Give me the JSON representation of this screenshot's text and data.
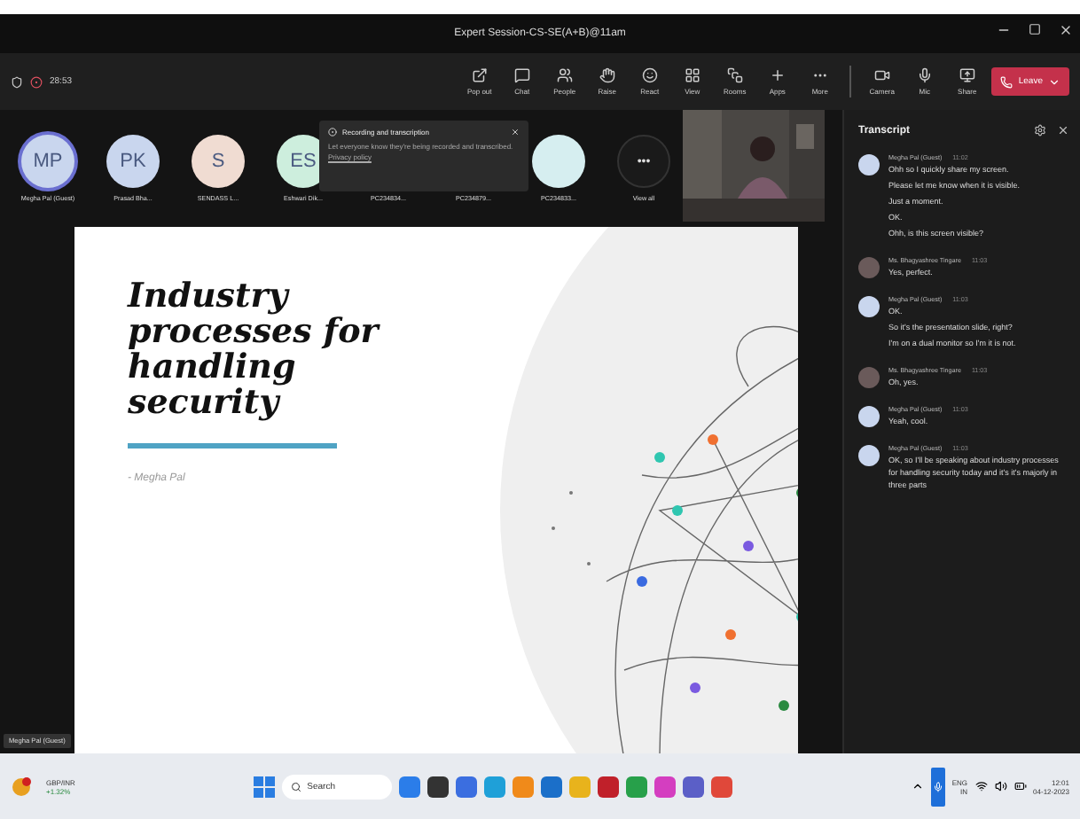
{
  "window": {
    "title": "Expert Session-CS-SE(A+B)@11am"
  },
  "toolbar": {
    "timer": "28:53",
    "buttons": [
      {
        "label": "Pop out"
      },
      {
        "label": "Chat"
      },
      {
        "label": "People"
      },
      {
        "label": "Raise"
      },
      {
        "label": "React"
      },
      {
        "label": "View"
      },
      {
        "label": "Rooms"
      },
      {
        "label": "Apps"
      },
      {
        "label": "More"
      }
    ],
    "device_buttons": [
      {
        "label": "Camera"
      },
      {
        "label": "Mic"
      },
      {
        "label": "Share"
      }
    ],
    "leave": "Leave"
  },
  "participants": [
    {
      "initials": "MP",
      "name": "Megha Pal (Guest)",
      "color": "#c9d6ee",
      "speaking": true
    },
    {
      "initials": "PK",
      "name": "Prasad Bha...",
      "color": "#c9d6ee",
      "speaking": false
    },
    {
      "initials": "S",
      "name": "SENDASS L...",
      "color": "#f0dcd2",
      "speaking": false
    },
    {
      "initials": "ES",
      "name": "Eshwari Dik...",
      "color": "#cdeedd",
      "speaking": false
    },
    {
      "name": "PC234834..."
    },
    {
      "name": "PC234879..."
    },
    {
      "name": "PC234833...",
      "color": "#d6eef0",
      "speaking": false
    }
  ],
  "view_all": {
    "icon": "•••",
    "label": "View all"
  },
  "notice": {
    "title": "Recording and transcription",
    "text": "Let everyone know they're being recorded and transcribed.",
    "link": "Privacy policy"
  },
  "slide": {
    "title": "Industry processes for handling security",
    "author": "- Megha Pal"
  },
  "presenter_label": "Megha Pal (Guest)",
  "transcript": {
    "title": "Transcript",
    "entries": [
      {
        "speaker": "Megha Pal (Guest)",
        "time": "11:02",
        "kind": "guest",
        "lines": [
          "Ohh so I quickly share my screen.",
          "Please let me know when it is visible.",
          "Just a moment.",
          "OK.",
          "Ohh, is this screen visible?"
        ]
      },
      {
        "speaker": "Ms. Bhagyashree Tingare",
        "time": "11:03",
        "kind": "member",
        "lines": [
          "Yes, perfect."
        ]
      },
      {
        "speaker": "Megha Pal (Guest)",
        "time": "11:03",
        "kind": "guest",
        "lines": [
          "OK.",
          "So it's the presentation slide, right?",
          "I'm on a dual monitor so I'm it is not."
        ]
      },
      {
        "speaker": "Ms. Bhagyashree Tingare",
        "time": "11:03",
        "kind": "member",
        "lines": [
          "Oh, yes."
        ]
      },
      {
        "speaker": "Megha Pal (Guest)",
        "time": "11:03",
        "kind": "guest",
        "lines": [
          "Yeah, cool."
        ]
      },
      {
        "speaker": "Megha Pal (Guest)",
        "time": "11:03",
        "kind": "guest",
        "lines": [
          "OK, so I'll be speaking about industry processes for handling security today and it's it's majorly in three parts"
        ]
      }
    ]
  },
  "taskbar": {
    "ticker": "GBP/INR",
    "change": "+1.32%",
    "search": "Search",
    "language": "ENG",
    "region": "IN",
    "time": "12:01",
    "date": "04-12-2023",
    "apps": [
      {
        "color": "#2b7de9"
      },
      {
        "color": "#333333"
      },
      {
        "color": "#3b6ee0"
      },
      {
        "color": "#1fa0d8"
      },
      {
        "color": "#f08a1a"
      },
      {
        "color": "#1b6fc9"
      },
      {
        "color": "#e8b31c"
      },
      {
        "color": "#c0202a"
      },
      {
        "color": "#27a04a"
      },
      {
        "color": "#d43ec0"
      },
      {
        "color": "#5b5fc7"
      },
      {
        "color": "#e0483a"
      }
    ]
  }
}
